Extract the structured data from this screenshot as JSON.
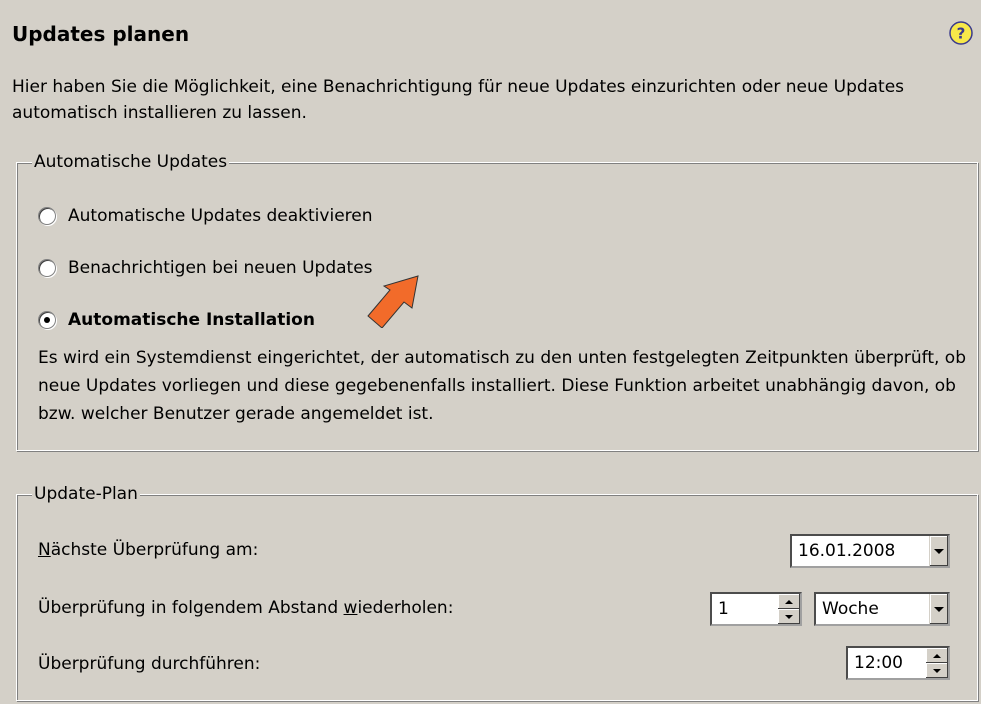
{
  "header": {
    "title": "Updates planen",
    "help_icon": "help-question-icon"
  },
  "intro": "Hier haben Sie die Möglichkeit, eine Benachrichtigung für neue Updates einzurichten oder neue Updates automatisch installieren zu lassen.",
  "auto_updates": {
    "legend": "Automatische Updates",
    "options": [
      {
        "label": "Automatische Updates deaktivieren",
        "checked": false
      },
      {
        "label": "Benachrichtigen bei neuen Updates",
        "checked": false
      },
      {
        "label": "Automatische Installation",
        "checked": true
      }
    ],
    "description": "Es wird ein Systemdienst eingerichtet, der automatisch zu den unten festgelegten Zeitpunkten überprüft, ob neue Updates vorliegen und diese gegebenenfalls installiert. Diese Funktion arbeitet unabhängig davon, ob bzw. welcher Benutzer gerade angemeldet ist."
  },
  "plan": {
    "legend": "Update-Plan",
    "next_check": {
      "label_accel": "N",
      "label_rest": "ächste Überprüfung am:",
      "value": "16.01.2008"
    },
    "repeat": {
      "label_pre": "Überprüfung in folgendem Abstand ",
      "label_accel": "w",
      "label_post": "iederholen:",
      "interval": "1",
      "unit": "Woche"
    },
    "run": {
      "label": "Überprüfung durchführen:",
      "time": "12:00"
    }
  },
  "colors": {
    "background": "#d4d0c8",
    "arrow": "#f26b2a"
  }
}
